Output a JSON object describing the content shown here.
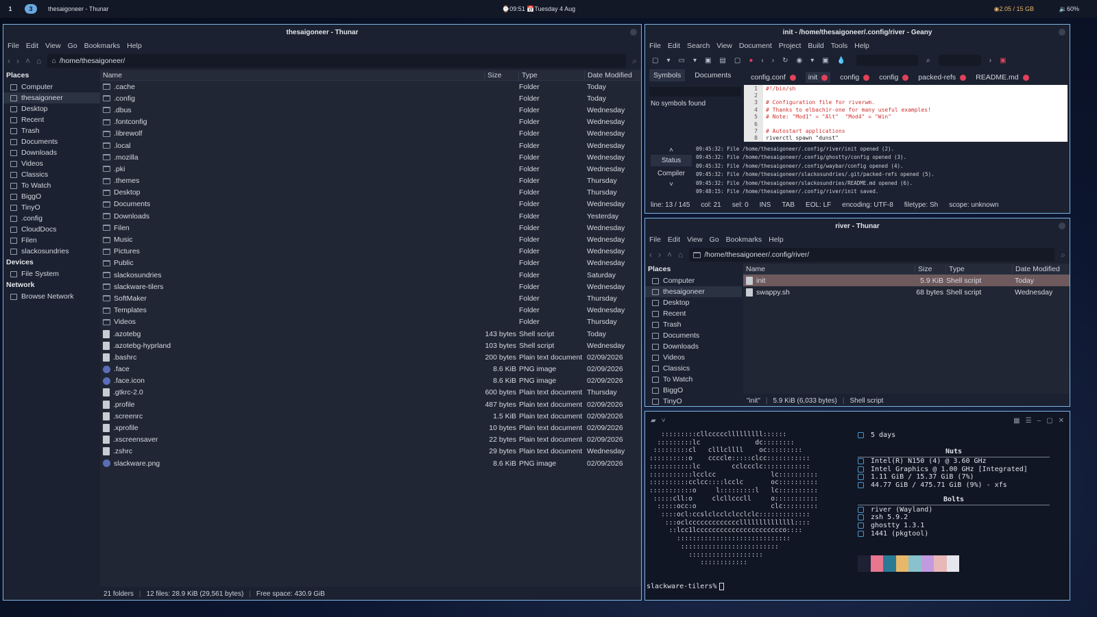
{
  "topbar": {
    "ws1": "1",
    "ws3": "3",
    "title": "thesaigoneer - Thunar",
    "clock": "⌚09:51 📅Tuesday 4 Aug",
    "mem": "2.05 / 15 GB",
    "vol": "60%"
  },
  "left": {
    "title": "thesaigoneer - Thunar",
    "menu": [
      "File",
      "Edit",
      "View",
      "Go",
      "Bookmarks",
      "Help"
    ],
    "path": "/home/thesaigoneer/",
    "places_header": "Places",
    "places": [
      "Computer",
      "thesaigoneer",
      "Desktop",
      "Recent",
      "Trash",
      "Documents",
      "Downloads",
      "Videos",
      "Classics",
      "To Watch",
      "BiggO",
      "TinyO",
      ".config",
      "CloudDocs",
      "Filen",
      "slackosundries"
    ],
    "devices_header": "Devices",
    "devices": [
      "File System"
    ],
    "network_header": "Network",
    "network": [
      "Browse Network"
    ],
    "cols": [
      "Name",
      "Size",
      "Type",
      "Date Modified"
    ],
    "rows": [
      [
        ".cache",
        "",
        "Folder",
        "Today",
        "f"
      ],
      [
        ".config",
        "",
        "Folder",
        "Today",
        "f"
      ],
      [
        ".dbus",
        "",
        "Folder",
        "Wednesday",
        "f"
      ],
      [
        ".fontconfig",
        "",
        "Folder",
        "Wednesday",
        "f"
      ],
      [
        ".librewolf",
        "",
        "Folder",
        "Wednesday",
        "f"
      ],
      [
        ".local",
        "",
        "Folder",
        "Wednesday",
        "f"
      ],
      [
        ".mozilla",
        "",
        "Folder",
        "Wednesday",
        "f"
      ],
      [
        ".pki",
        "",
        "Folder",
        "Wednesday",
        "f"
      ],
      [
        ".themes",
        "",
        "Folder",
        "Thursday",
        "f"
      ],
      [
        "Desktop",
        "",
        "Folder",
        "Thursday",
        "f"
      ],
      [
        "Documents",
        "",
        "Folder",
        "Wednesday",
        "f"
      ],
      [
        "Downloads",
        "",
        "Folder",
        "Yesterday",
        "f"
      ],
      [
        "Filen",
        "",
        "Folder",
        "Wednesday",
        "f"
      ],
      [
        "Music",
        "",
        "Folder",
        "Wednesday",
        "f"
      ],
      [
        "Pictures",
        "",
        "Folder",
        "Wednesday",
        "f"
      ],
      [
        "Public",
        "",
        "Folder",
        "Wednesday",
        "f"
      ],
      [
        "slackosundries",
        "",
        "Folder",
        "Saturday",
        "f"
      ],
      [
        "slackware-tilers",
        "",
        "Folder",
        "Wednesday",
        "f"
      ],
      [
        "SoftMaker",
        "",
        "Folder",
        "Thursday",
        "f"
      ],
      [
        "Templates",
        "",
        "Folder",
        "Wednesday",
        "f"
      ],
      [
        "Videos",
        "",
        "Folder",
        "Thursday",
        "f"
      ],
      [
        ".azotebg",
        "143 bytes",
        "Shell script",
        "Today",
        "d"
      ],
      [
        ".azotebg-hyprland",
        "103 bytes",
        "Shell script",
        "Wednesday",
        "d"
      ],
      [
        ".bashrc",
        "200 bytes",
        "Plain text document",
        "02/09/2026",
        "d"
      ],
      [
        ".face",
        "8.6 KiB",
        "PNG image",
        "02/09/2026",
        "p"
      ],
      [
        ".face.icon",
        "8.6 KiB",
        "PNG image",
        "02/09/2026",
        "p"
      ],
      [
        ".gtkrc-2.0",
        "600 bytes",
        "Plain text document",
        "Thursday",
        "d"
      ],
      [
        ".profile",
        "487 bytes",
        "Plain text document",
        "02/09/2026",
        "d"
      ],
      [
        ".screenrc",
        "1.5 KiB",
        "Plain text document",
        "02/09/2026",
        "d"
      ],
      [
        ".xprofile",
        "10 bytes",
        "Plain text document",
        "02/09/2026",
        "d"
      ],
      [
        ".xscreensaver",
        "22 bytes",
        "Plain text document",
        "02/09/2026",
        "d"
      ],
      [
        ".zshrc",
        "29 bytes",
        "Plain text document",
        "Wednesday",
        "d"
      ],
      [
        "slackware.png",
        "8.6 KiB",
        "PNG image",
        "02/09/2026",
        "p"
      ]
    ],
    "status": [
      "21 folders",
      "12 files: 28.9 KiB (29,561 bytes)",
      "Free space: 430.9 GiB"
    ]
  },
  "geany": {
    "title": "init - /home/thesaigoneer/.config/river - Geany",
    "menu": [
      "File",
      "Edit",
      "Search",
      "View",
      "Document",
      "Project",
      "Build",
      "Tools",
      "Help"
    ],
    "sidetabs": [
      "Symbols",
      "Documents"
    ],
    "nosym": "No symbols found",
    "tabs": [
      "config.conf",
      "init",
      "config",
      "config",
      "packed-refs",
      "README.md"
    ],
    "code": [
      [
        "1",
        "#!/bin/sh"
      ],
      [
        "2",
        ""
      ],
      [
        "3",
        "# Configuration file for riverwm."
      ],
      [
        "4",
        "# Thanks to elbachir-one for many useful examples!"
      ],
      [
        "5",
        "# Note: \"Mod1\" = \"Alt\"  \"Mod4\" = \"Win\""
      ],
      [
        "6",
        ""
      ],
      [
        "7",
        "# Autostart applications"
      ],
      [
        "8",
        "riverctl spawn \"dunst\""
      ]
    ],
    "msgtabs": [
      "Status",
      "Compiler"
    ],
    "log": [
      "09:45:32: File /home/thesaigoneer/.config/river/init opened (2).",
      "09:45:32: File /home/thesaigoneer/.config/ghostty/config opened (3).",
      "09:45:32: File /home/thesaigoneer/.config/waybar/config opened (4).",
      "09:45:32: File /home/thesaigoneer/slackosundries/.git/packed-refs opened (5).",
      "09:45:32: File /home/thesaigoneer/slackosundries/README.md opened (6).",
      "09:48:15: File /home/thesaigoneer/.config/river/init saved."
    ],
    "status": [
      "line: 13 / 145",
      "col: 21",
      "sel: 0",
      "INS",
      "TAB",
      "EOL: LF",
      "encoding: UTF-8",
      "filetype: Sh",
      "scope: unknown"
    ]
  },
  "river": {
    "title": "river - Thunar",
    "menu": [
      "File",
      "Edit",
      "View",
      "Go",
      "Bookmarks",
      "Help"
    ],
    "path": "/home/thesaigoneer/.config/river/",
    "places_header": "Places",
    "places": [
      "Computer",
      "thesaigoneer",
      "Desktop",
      "Recent",
      "Trash",
      "Documents",
      "Downloads",
      "Videos",
      "Classics",
      "To Watch",
      "BiggO",
      "TinyO"
    ],
    "cols": [
      "Name",
      "Size",
      "Type",
      "Date Modified"
    ],
    "rows": [
      [
        "init",
        "5.9 KiB",
        "Shell script",
        "Today"
      ],
      [
        "swappy.sh",
        "68 bytes",
        "Shell script",
        "Wednesday"
      ]
    ],
    "status": [
      "\"init\"",
      "5.9 KiB (6,033 bytes)",
      "Shell script"
    ]
  },
  "term": {
    "art": [
      "   :::::::::cllccccclllllllll::::::",
      "  :::::::::lc              dc::::::::",
      " :::::::::cl   clllcllll    oc:::::::::",
      "::::::::::o    ccccle:::::clcc:::::::::::",
      ":::::::::::lc        cclccclc::::::::::::",
      ":::::::::::lcclcc              lc::::::::::",
      "::::::::::cclcc::::lcclc       oc::::::::::",
      ":::::::::::o     l:::::::::l   lc::::::::::",
      " :::::cll:o     clcllcccll     o:::::::::::",
      "  :::::occ:o                   clc:::::::::",
      "   ::::ocl:ccslclcclclcclclc:::::::::::::",
      "    :::oclcccccccccccccllllllllllllll::::",
      "     ::lcc1lcccccccccccccccccccccco::::",
      "       :::::::::::::::::::::::::::::",
      "        :::::::::::::::::::::::::",
      "          :::::::::::::::::::",
      "             ::::::::::::"
    ],
    "uptime": "5 days",
    "nuts_title": "Nuts",
    "nuts": [
      "Intel(R) N150 (4) @ 3.60 GHz",
      "Intel Graphics @ 1.00 GHz [Integrated]",
      "1.11 GiB / 15.37 GiB (7%)",
      "44.77 GiB / 475.71 GiB (9%) - xfs"
    ],
    "bolts_title": "Bolts",
    "bolts": [
      "river (Wayland)",
      "zsh 5.9.2",
      "ghostty 1.3.1",
      "1441 (pkgtool)"
    ],
    "prompt": "slackware-tilers%",
    "palette": [
      "#1d2133",
      "#e8768f",
      "#2a7a96",
      "#e8b86a",
      "#89c2cc",
      "#c29adf",
      "#e8b8b8",
      "#e6e6ee"
    ]
  }
}
